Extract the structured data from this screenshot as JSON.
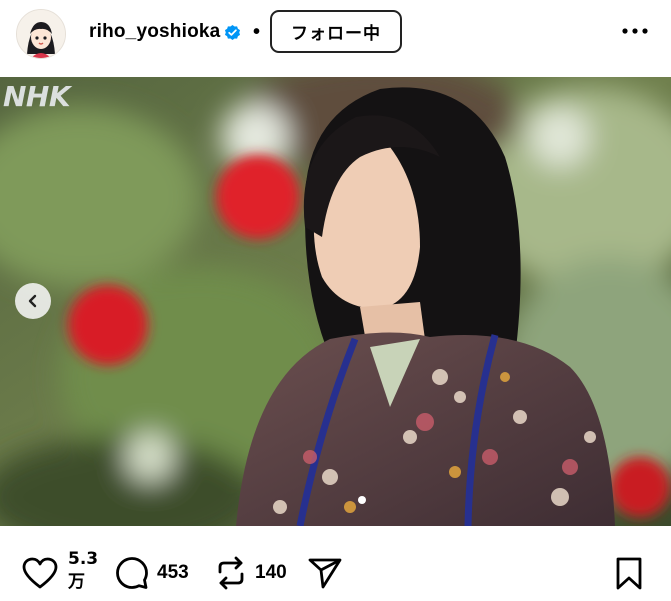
{
  "post": {
    "username": "riho_yoshioka",
    "separator": "•",
    "follow_label": "フォロー中",
    "watermark": "NHK"
  },
  "actions": {
    "likes_line1": "5.3",
    "likes_line2": "万",
    "comments": "453",
    "reposts": "140"
  },
  "icons": [
    "avatar",
    "verified-badge-icon",
    "more-icon",
    "chevron-left-icon",
    "heart-icon",
    "comment-icon",
    "repost-icon",
    "share-icon",
    "bookmark-icon"
  ],
  "colors": {
    "verified": "#0095f6",
    "text": "#000000",
    "background": "#ffffff"
  }
}
